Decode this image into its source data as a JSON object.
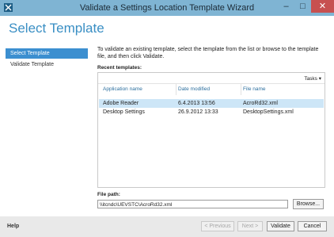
{
  "window": {
    "title": "Validate a Settings Location Template Wizard",
    "minimize_glyph": "–",
    "maximize_glyph": "□",
    "close_glyph": "✕",
    "app_icon": "wizard-app-icon"
  },
  "page": {
    "heading": "Select Template"
  },
  "sidebar": {
    "items": [
      {
        "label": "Select Template",
        "selected": true
      },
      {
        "label": "Validate Template",
        "selected": false
      }
    ]
  },
  "main": {
    "instructions": "To validate an existing template, select the template from the list or browse to the template file, and then click Validate.",
    "recent_label": "Recent templates:",
    "tasks_label": "Tasks ▾",
    "columns": [
      "Application name",
      "Date modified",
      "File name"
    ],
    "rows": [
      {
        "name": "Adobe Reader",
        "date": "6.4.2013 13:56",
        "file": "AcroRd32.xml",
        "selected": true
      },
      {
        "name": "Desktop Settings",
        "date": "26.9.2012 13:33",
        "file": "DesktopSettings.xml",
        "selected": false
      }
    ],
    "filepath_label": "File path:",
    "filepath_value": "\\\\itcndc\\UEVSTC\\AcroRd32.xml",
    "browse_label": "Browse..."
  },
  "footer": {
    "help_label": "Help",
    "previous_label": "< Previous",
    "next_label": "Next >",
    "validate_label": "Validate",
    "cancel_label": "Cancel"
  },
  "colors": {
    "titlebar": "#7fb4d3",
    "accent": "#3a8fc4",
    "selection": "#3c8fd0",
    "row_selection": "#cde6f7",
    "close_button": "#c75050"
  }
}
